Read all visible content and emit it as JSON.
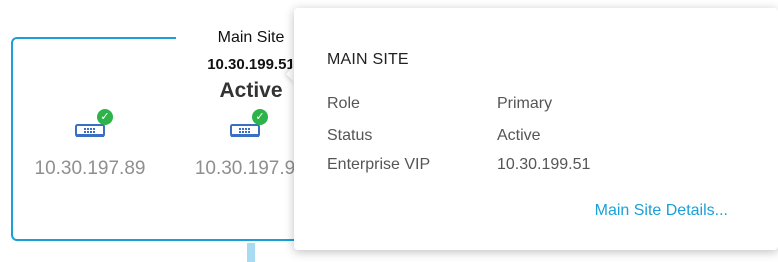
{
  "site": {
    "name": "Main Site",
    "vip": "10.30.199.51",
    "state": "Active",
    "nodes": [
      {
        "ip": "10.30.197.89",
        "status_icon": "check-icon",
        "device_icon": "switch-icon"
      },
      {
        "ip": "10.30.197.9",
        "status_icon": "check-icon",
        "device_icon": "switch-icon"
      }
    ]
  },
  "popover": {
    "title": "MAIN SITE",
    "rows": [
      {
        "label": "Role",
        "value": "Primary"
      },
      {
        "label": "Status",
        "value": "Active"
      },
      {
        "label": "Enterprise VIP",
        "value": "10.30.199.51"
      }
    ],
    "link": "Main Site Details..."
  },
  "colors": {
    "accent": "#1aa0d8",
    "success": "#2db34a",
    "device": "#3b6fc4",
    "muted_text": "#8f8f8f",
    "connector": "#a8dbf2"
  },
  "check_glyph": "✓"
}
